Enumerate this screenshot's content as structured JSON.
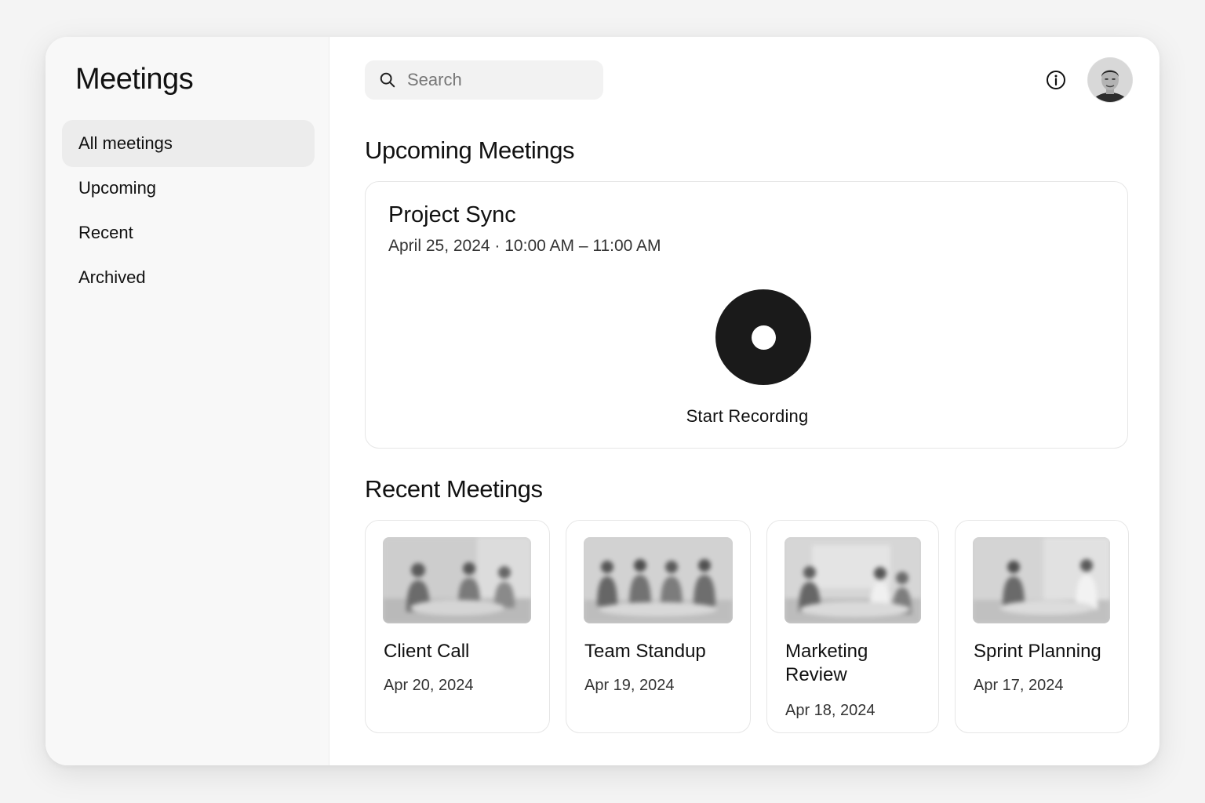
{
  "sidebar": {
    "title": "Meetings",
    "items": [
      {
        "label": "All meetings",
        "active": true
      },
      {
        "label": "Upcoming",
        "active": false
      },
      {
        "label": "Recent",
        "active": false
      },
      {
        "label": "Archived",
        "active": false
      }
    ]
  },
  "header": {
    "search_placeholder": "Search",
    "info_icon": "info-icon",
    "avatar_icon": "user-avatar"
  },
  "upcoming": {
    "section_title": "Upcoming Meetings",
    "meeting": {
      "name": "Project Sync",
      "time": "April 25, 2024 · 10:00 AM – 11:00 AM",
      "record_label": "Start Recording",
      "record_icon": "record-icon"
    }
  },
  "recent": {
    "section_title": "Recent Meetings",
    "meetings": [
      {
        "title": "Client Call",
        "date": "Apr 20, 2024"
      },
      {
        "title": "Team Standup",
        "date": "Apr 19, 2024"
      },
      {
        "title": "Marketing Review",
        "date": "Apr 18, 2024"
      },
      {
        "title": "Sprint Planning",
        "date": "Apr 17, 2024"
      }
    ]
  },
  "colors": {
    "background": "#f4f4f4",
    "sidebar": "#f8f8f8",
    "active_nav": "#ececec",
    "record_button": "#1a1a1a"
  }
}
